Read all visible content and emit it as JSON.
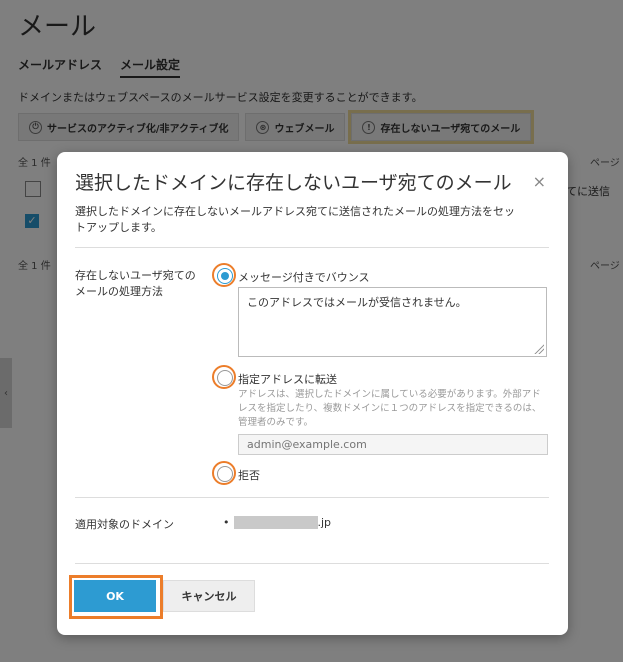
{
  "background": {
    "page_title": "メール",
    "tabs": [
      {
        "label": "メールアドレス",
        "active": false
      },
      {
        "label": "メール設定",
        "active": true
      }
    ],
    "description": "ドメインまたはウェブスペースのメールサービス設定を変更することができます。",
    "subtabs": [
      {
        "label": "サービスのアクティブ化/非アクティブ化",
        "icon": "power-icon"
      },
      {
        "label": "ウェブメール",
        "icon": "webmail-icon"
      },
      {
        "label": "存在しないユーザ宛てのメール",
        "icon": "warning-icon",
        "active": true
      }
    ],
    "total_top": "全 1 件",
    "total_bottom": "全 1 件",
    "pager_top": "ページ",
    "pager_bottom": "ページ",
    "row_cell": "てに送信"
  },
  "dialog": {
    "title": "選択したドメインに存在しないユーザ宛てのメール",
    "close": "×",
    "description": "選択したドメインに存在しないメールアドレス宛てに送信されたメールの処理方法をセットアップします。",
    "method_label": "存在しないユーザ宛てのメールの処理方法",
    "options": {
      "bounce": {
        "label": "メッセージ付きでバウンス",
        "selected": true,
        "message": "このアドレスではメールが受信されません。"
      },
      "forward": {
        "label": "指定アドレスに転送",
        "selected": false,
        "help": "アドレスは、選択したドメインに属している必要があります。外部アドレスを指定したり、複数ドメインに１つのアドレスを指定できるのは、管理者のみです。",
        "placeholder": "admin@example.com"
      },
      "reject": {
        "label": "拒否",
        "selected": false
      }
    },
    "domain_label": "適用対象のドメイン",
    "domain_bullet": "•",
    "domain_suffix": ".jp",
    "ok": "OK",
    "cancel": "キャンセル"
  },
  "colors": {
    "primary": "#2d9bd2",
    "highlight": "#ec7d2a",
    "tab_highlight": "#f1dc9b"
  }
}
